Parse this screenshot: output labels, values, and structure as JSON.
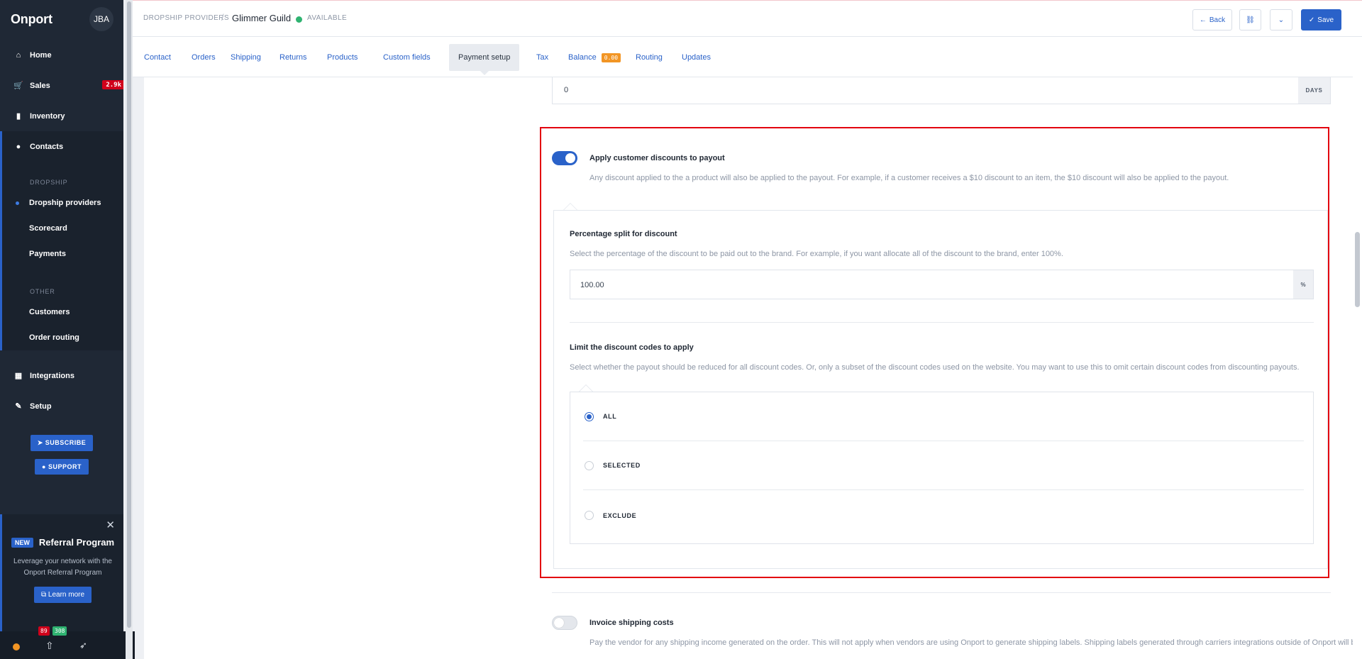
{
  "sidebar": {
    "logo": "Onport",
    "avatar": "JBA",
    "nav": [
      {
        "label": "Home",
        "icon": "home-icon",
        "glyph": "⌂"
      },
      {
        "label": "Sales",
        "icon": "cart-icon",
        "glyph": "🛒",
        "badge": "2.9k"
      },
      {
        "label": "Inventory",
        "icon": "bookmark-icon",
        "glyph": "▮"
      },
      {
        "label": "Contacts",
        "icon": "user-icon",
        "glyph": "●"
      }
    ],
    "dropship_heading": "DROPSHIP",
    "dropship_items": [
      "Dropship providers",
      "Scorecard",
      "Payments"
    ],
    "other_heading": "OTHER",
    "other_items": [
      "Customers",
      "Order routing"
    ],
    "nav2": [
      {
        "label": "Integrations",
        "icon": "grid-icon",
        "glyph": "▦"
      },
      {
        "label": "Setup",
        "icon": "wrench-icon",
        "glyph": "🔧"
      }
    ],
    "subscribe_label": "SUBSCRIBE",
    "support_label": "SUPPORT",
    "referral": {
      "badge": "NEW",
      "title": "Referral Program",
      "description": "Leverage your network with the Onport Referral Program",
      "button": "Learn more"
    },
    "counters": {
      "red": "89",
      "green": "308"
    }
  },
  "header": {
    "breadcrumb": "DROPSHIP PROVIDERS",
    "separator": "/",
    "title": "Glimmer Guild",
    "status": "AVAILABLE",
    "back_label": "Back",
    "save_label": "Save"
  },
  "tabs": [
    {
      "label": "Contact"
    },
    {
      "label": "Orders"
    },
    {
      "label": "Shipping"
    },
    {
      "label": "Returns"
    },
    {
      "label": "Products"
    },
    {
      "label": "Custom fields"
    },
    {
      "label": "Payment setup",
      "active": true
    },
    {
      "label": "Tax"
    },
    {
      "label": "Balance",
      "badge": "0.00"
    },
    {
      "label": "Routing"
    },
    {
      "label": "Updates"
    }
  ],
  "form": {
    "days_value": "0",
    "days_unit": "DAYS",
    "discounts": {
      "enabled": true,
      "title": "Apply customer discounts to payout",
      "description": "Any discount applied to the a product will also be applied to the payout. For example, if a customer receives a $10 discount to an item, the $10 discount will also be applied to the payout."
    },
    "split": {
      "title": "Percentage split for discount",
      "description": "Select the percentage of the discount to be paid out to the brand. For example, if you want allocate all of the discount to the brand, enter 100%.",
      "value": "100.00",
      "unit": "%"
    },
    "limit": {
      "title": "Limit the discount codes to apply",
      "description": "Select whether the payout should be reduced for all discount codes. Or, only a subset of the discount codes used on the website. You may want to use this to omit certain discount codes from discounting payouts.",
      "options": [
        "ALL",
        "SELECTED",
        "EXCLUDE"
      ],
      "selected": "ALL"
    },
    "invoice_shipping": {
      "enabled": false,
      "title": "Invoice shipping costs",
      "description": "Pay the vendor for any shipping income generated on the order. This will not apply when vendors are using Onport to generate shipping labels. Shipping labels generated through carriers integrations outside of Onport will be"
    }
  },
  "colors": {
    "accent": "#2a62c9",
    "sidebar_bg": "#1f2835",
    "highlight": "#e3000f",
    "available": "#2fb371",
    "badge_orange": "#f29524",
    "badge_red": "#d0021b"
  }
}
